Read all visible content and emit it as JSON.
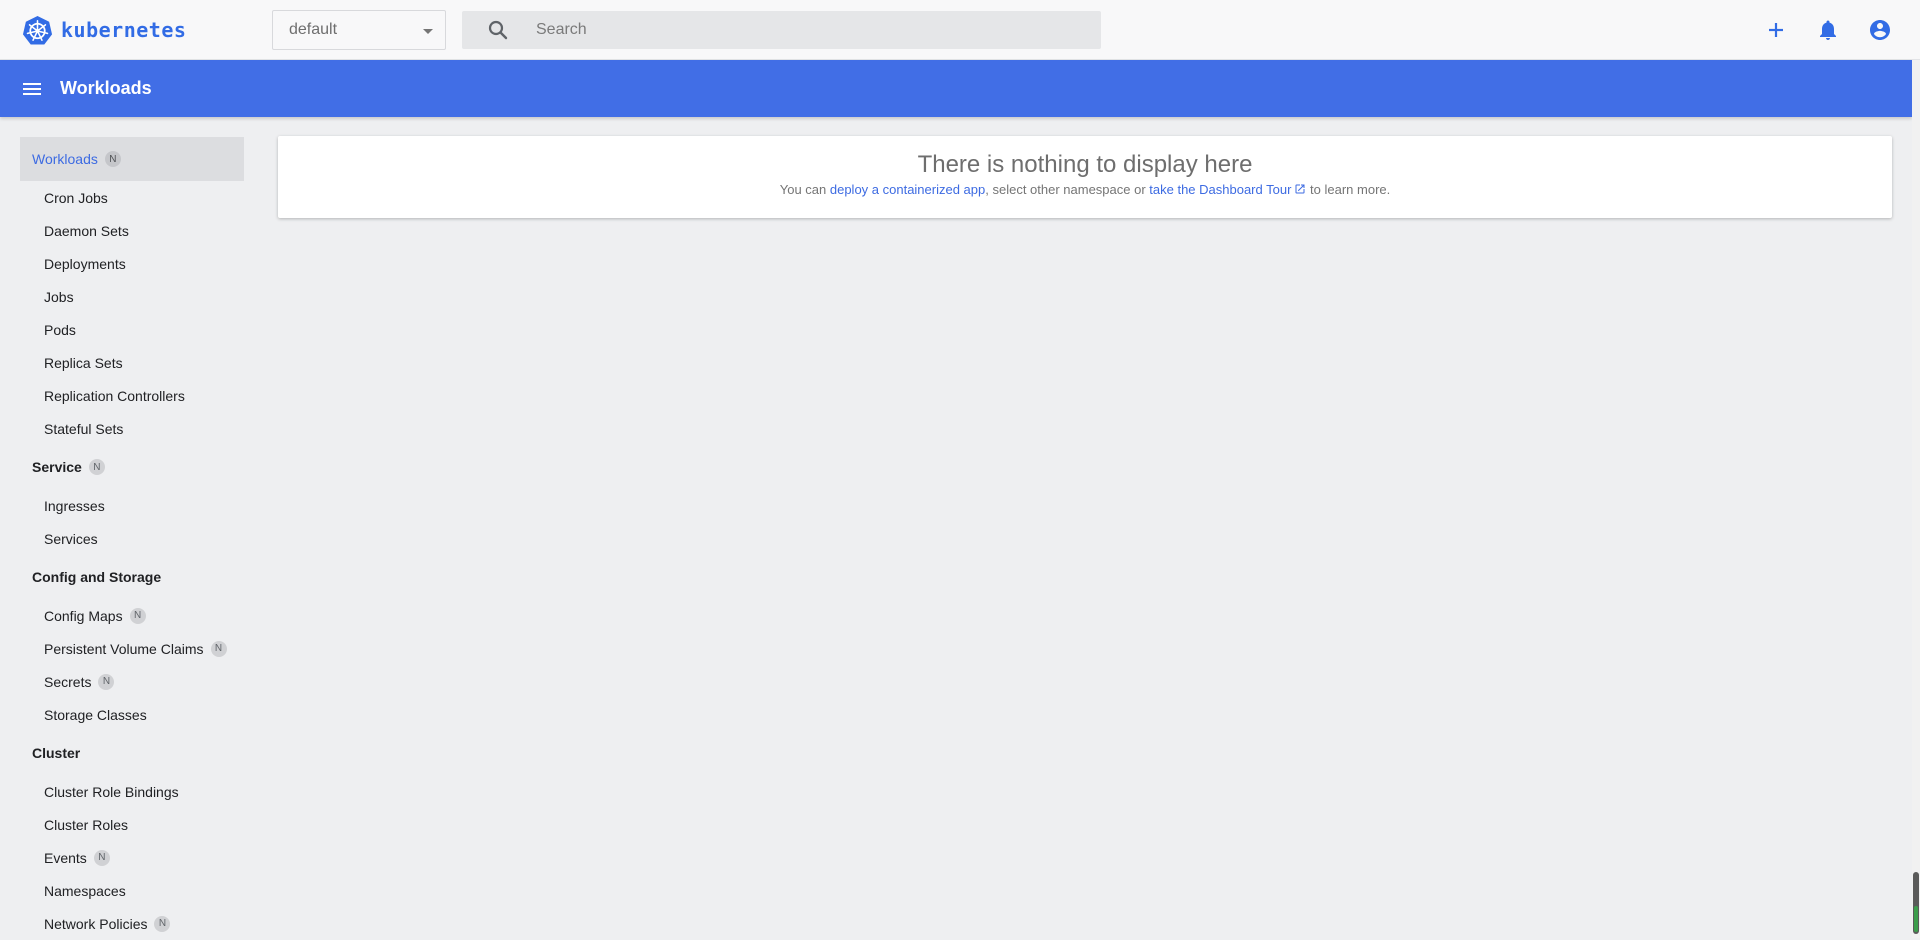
{
  "app": {
    "logo_text": "kubernetes"
  },
  "namespace_select": {
    "value": "default"
  },
  "search": {
    "placeholder": "Search"
  },
  "titlebar": {
    "title": "Workloads"
  },
  "sidebar": {
    "workloads": {
      "label": "Workloads",
      "badge": "N",
      "items": [
        {
          "label": "Cron Jobs"
        },
        {
          "label": "Daemon Sets"
        },
        {
          "label": "Deployments"
        },
        {
          "label": "Jobs"
        },
        {
          "label": "Pods"
        },
        {
          "label": "Replica Sets"
        },
        {
          "label": "Replication Controllers"
        },
        {
          "label": "Stateful Sets"
        }
      ]
    },
    "service": {
      "label": "Service",
      "badge": "N",
      "items": [
        {
          "label": "Ingresses"
        },
        {
          "label": "Services"
        }
      ]
    },
    "config": {
      "label": "Config and Storage",
      "items": [
        {
          "label": "Config Maps",
          "badge": "N"
        },
        {
          "label": "Persistent Volume Claims",
          "badge": "N"
        },
        {
          "label": "Secrets",
          "badge": "N"
        },
        {
          "label": "Storage Classes"
        }
      ]
    },
    "cluster": {
      "label": "Cluster",
      "items": [
        {
          "label": "Cluster Role Bindings"
        },
        {
          "label": "Cluster Roles"
        },
        {
          "label": "Events",
          "badge": "N"
        },
        {
          "label": "Namespaces"
        },
        {
          "label": "Network Policies",
          "badge": "N"
        }
      ]
    }
  },
  "main": {
    "empty_title": "There is nothing to display here",
    "text_prefix": "You can ",
    "link_deploy": "deploy a containerized app",
    "text_middle": ", select other namespace or ",
    "link_tour": "take the Dashboard Tour",
    "text_suffix": " to learn more."
  },
  "colors": {
    "accent": "#326ce5",
    "titlebar": "#416ee6",
    "background": "#eeeff1"
  }
}
